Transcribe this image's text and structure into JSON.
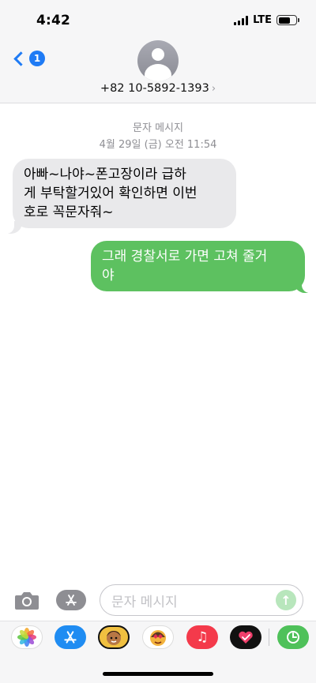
{
  "status_bar": {
    "time": "4:42",
    "network": "LTE"
  },
  "nav": {
    "back_badge": "1",
    "contact": "+82 10-5892-1393"
  },
  "thread": {
    "kind": "문자 메시지",
    "timestamp": "4월 29일 (금) 오전 11:54",
    "messages": [
      {
        "direction": "incoming",
        "lines": [
          "아빠~나야~폰고장이라  급하",
          "게 부탁할거있어 확인하면 이번",
          "호로 꼭문자줘~"
        ]
      },
      {
        "direction": "outgoing",
        "lines": [
          "그래 경찰서로 가면 고쳐 줄거",
          "야"
        ]
      }
    ]
  },
  "composer": {
    "placeholder": "문자 메시지"
  },
  "app_drawer": {
    "apps": [
      {
        "name": "photos",
        "icon": "photos-icon"
      },
      {
        "name": "app-store",
        "icon": "app-store-icon"
      },
      {
        "name": "memoji",
        "icon": "memoji-icon"
      },
      {
        "name": "animoji-stickers",
        "icon": "animoji-icon"
      },
      {
        "name": "music",
        "icon": "music-icon"
      },
      {
        "name": "digital-touch",
        "icon": "digital-touch-icon"
      },
      {
        "name": "screen-time",
        "icon": "screen-time-icon"
      }
    ]
  },
  "colors": {
    "accent": "#1f7bf5",
    "incoming_bubble": "#e9e9eb",
    "outgoing_bubble": "#5dc160"
  }
}
